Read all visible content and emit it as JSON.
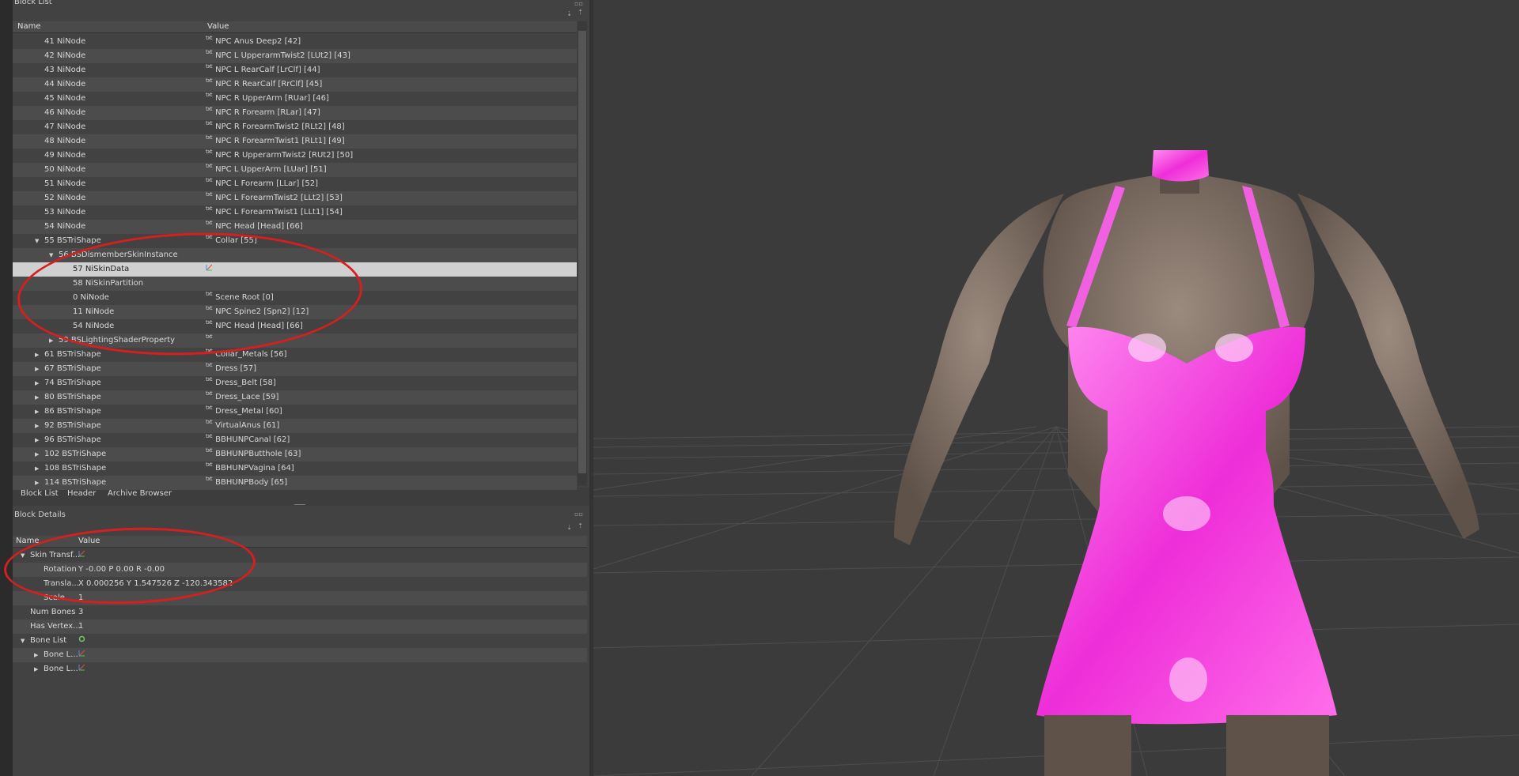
{
  "block_list": {
    "title": "Block List",
    "columns": {
      "name": "Name",
      "value": "Value"
    },
    "rows": [
      {
        "indent": 0,
        "expand": "",
        "name": "41 NiNode",
        "icon": "txt",
        "value": "NPC Anus Deep2 [42]"
      },
      {
        "indent": 0,
        "expand": "",
        "name": "42 NiNode",
        "icon": "txt",
        "value": "NPC L UpperarmTwist2 [LUt2] [43]"
      },
      {
        "indent": 0,
        "expand": "",
        "name": "43 NiNode",
        "icon": "txt",
        "value": "NPC L RearCalf [LrClf] [44]"
      },
      {
        "indent": 0,
        "expand": "",
        "name": "44 NiNode",
        "icon": "txt",
        "value": "NPC R RearCalf [RrClf] [45]"
      },
      {
        "indent": 0,
        "expand": "",
        "name": "45 NiNode",
        "icon": "txt",
        "value": "NPC R UpperArm [RUar] [46]"
      },
      {
        "indent": 0,
        "expand": "",
        "name": "46 NiNode",
        "icon": "txt",
        "value": "NPC R Forearm [RLar] [47]"
      },
      {
        "indent": 0,
        "expand": "",
        "name": "47 NiNode",
        "icon": "txt",
        "value": "NPC R ForearmTwist2 [RLt2] [48]"
      },
      {
        "indent": 0,
        "expand": "",
        "name": "48 NiNode",
        "icon": "txt",
        "value": "NPC R ForearmTwist1 [RLt1] [49]"
      },
      {
        "indent": 0,
        "expand": "",
        "name": "49 NiNode",
        "icon": "txt",
        "value": "NPC R UpperarmTwist2 [RUt2] [50]"
      },
      {
        "indent": 0,
        "expand": "",
        "name": "50 NiNode",
        "icon": "txt",
        "value": "NPC L UpperArm [LUar] [51]"
      },
      {
        "indent": 0,
        "expand": "",
        "name": "51 NiNode",
        "icon": "txt",
        "value": "NPC L Forearm [LLar] [52]"
      },
      {
        "indent": 0,
        "expand": "",
        "name": "52 NiNode",
        "icon": "txt",
        "value": "NPC L ForearmTwist2 [LLt2] [53]"
      },
      {
        "indent": 0,
        "expand": "",
        "name": "53 NiNode",
        "icon": "txt",
        "value": "NPC L ForearmTwist1 [LLt1] [54]"
      },
      {
        "indent": 0,
        "expand": "",
        "name": "54 NiNode",
        "icon": "txt",
        "value": "NPC Head [Head] [66]"
      },
      {
        "indent": 0,
        "expand": "open",
        "name": "55 BSTriShape",
        "icon": "txt",
        "value": "Collar [55]"
      },
      {
        "indent": 1,
        "expand": "open",
        "name": "56 BSDismemberSkinInstance",
        "icon": "",
        "value": ""
      },
      {
        "indent": 2,
        "expand": "",
        "name": "57 NiSkinData",
        "icon": "axes",
        "value": "",
        "selected": true
      },
      {
        "indent": 2,
        "expand": "",
        "name": "58 NiSkinPartition",
        "icon": "",
        "value": ""
      },
      {
        "indent": 2,
        "expand": "",
        "name": "0 NiNode",
        "icon": "txt",
        "value": "Scene Root [0]"
      },
      {
        "indent": 2,
        "expand": "",
        "name": "11 NiNode",
        "icon": "txt",
        "value": "NPC Spine2 [Spn2] [12]"
      },
      {
        "indent": 2,
        "expand": "",
        "name": "54 NiNode",
        "icon": "txt",
        "value": "NPC Head [Head] [66]"
      },
      {
        "indent": 1,
        "expand": "closed",
        "name": "59 BSLightingShaderProperty",
        "icon": "txt",
        "value": ""
      },
      {
        "indent": 0,
        "expand": "closed",
        "name": "61 BSTriShape",
        "icon": "txt",
        "value": "Collar_Metals [56]"
      },
      {
        "indent": 0,
        "expand": "closed",
        "name": "67 BSTriShape",
        "icon": "txt",
        "value": "Dress [57]"
      },
      {
        "indent": 0,
        "expand": "closed",
        "name": "74 BSTriShape",
        "icon": "txt",
        "value": "Dress_Belt [58]"
      },
      {
        "indent": 0,
        "expand": "closed",
        "name": "80 BSTriShape",
        "icon": "txt",
        "value": "Dress_Lace [59]"
      },
      {
        "indent": 0,
        "expand": "closed",
        "name": "86 BSTriShape",
        "icon": "txt",
        "value": "Dress_Metal [60]"
      },
      {
        "indent": 0,
        "expand": "closed",
        "name": "92 BSTriShape",
        "icon": "txt",
        "value": "VirtualAnus [61]"
      },
      {
        "indent": 0,
        "expand": "closed",
        "name": "96 BSTriShape",
        "icon": "txt",
        "value": "BBHUNPCanal [62]"
      },
      {
        "indent": 0,
        "expand": "closed",
        "name": "102 BSTriShape",
        "icon": "txt",
        "value": "BBHUNPButthole [63]"
      },
      {
        "indent": 0,
        "expand": "closed",
        "name": "108 BSTriShape",
        "icon": "txt",
        "value": "BBHUNPVagina [64]"
      },
      {
        "indent": 0,
        "expand": "closed",
        "name": "114 BSTriShape",
        "icon": "txt",
        "value": "BBHUNPBody [65]"
      }
    ]
  },
  "tabs": [
    "Block List",
    "Header",
    "Archive Browser"
  ],
  "block_details": {
    "title": "Block Details",
    "columns": {
      "name": "Name",
      "value": "Value"
    },
    "rows": [
      {
        "indent": 0,
        "expand": "open",
        "name": "Skin Transf...",
        "icon": "axes",
        "value": ""
      },
      {
        "indent": 1,
        "expand": "",
        "name": "Rotation",
        "icon": "",
        "value": "Y -0.00 P 0.00 R -0.00"
      },
      {
        "indent": 1,
        "expand": "",
        "name": "Transla...",
        "icon": "",
        "value": "X 0.000256 Y 1.547526 Z -120.343582"
      },
      {
        "indent": 1,
        "expand": "",
        "name": "Scale",
        "icon": "",
        "value": "1"
      },
      {
        "indent": 0,
        "expand": "",
        "name": "Num Bones",
        "icon": "",
        "value": "3"
      },
      {
        "indent": 0,
        "expand": "",
        "name": "Has Vertex...",
        "icon": "",
        "value": "1"
      },
      {
        "indent": 0,
        "expand": "open",
        "name": "Bone List",
        "icon": "refresh",
        "value": ""
      },
      {
        "indent": 1,
        "expand": "closed",
        "name": "Bone L...",
        "icon": "axes",
        "value": ""
      },
      {
        "indent": 1,
        "expand": "closed",
        "name": "Bone L...",
        "icon": "axes",
        "value": ""
      }
    ]
  },
  "colors": {
    "dress": "#ff4fe0",
    "skin": "#7a6a60",
    "annotation": "#d61f1f",
    "background": "#3b3b3b"
  }
}
